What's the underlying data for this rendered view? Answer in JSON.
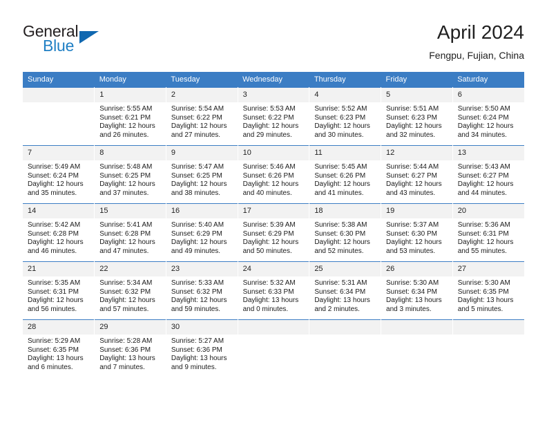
{
  "brand": {
    "name_part1": "General",
    "name_part2": "Blue",
    "triangle_icon": "triangle-logo-icon",
    "accent_color": "#1168b0"
  },
  "header": {
    "title": "April 2024",
    "subtitle": "Fengpu, Fujian, China"
  },
  "theme": {
    "header_row_bg": "#3b7dc4",
    "daynum_bg": "#f2f2f2",
    "grid_line": "#3b7dc4",
    "text": "#1a1a1a"
  },
  "weekday_headers": [
    "Sunday",
    "Monday",
    "Tuesday",
    "Wednesday",
    "Thursday",
    "Friday",
    "Saturday"
  ],
  "labels": {
    "sunrise_prefix": "Sunrise:",
    "sunset_prefix": "Sunset:",
    "daylight_prefix": "Daylight:"
  },
  "weeks": [
    [
      {
        "day": "",
        "sunrise": "",
        "sunset": "",
        "daylight_line1": "",
        "daylight_line2": ""
      },
      {
        "day": "1",
        "sunrise": "Sunrise: 5:55 AM",
        "sunset": "Sunset: 6:21 PM",
        "daylight_line1": "Daylight: 12 hours",
        "daylight_line2": "and 26 minutes."
      },
      {
        "day": "2",
        "sunrise": "Sunrise: 5:54 AM",
        "sunset": "Sunset: 6:22 PM",
        "daylight_line1": "Daylight: 12 hours",
        "daylight_line2": "and 27 minutes."
      },
      {
        "day": "3",
        "sunrise": "Sunrise: 5:53 AM",
        "sunset": "Sunset: 6:22 PM",
        "daylight_line1": "Daylight: 12 hours",
        "daylight_line2": "and 29 minutes."
      },
      {
        "day": "4",
        "sunrise": "Sunrise: 5:52 AM",
        "sunset": "Sunset: 6:23 PM",
        "daylight_line1": "Daylight: 12 hours",
        "daylight_line2": "and 30 minutes."
      },
      {
        "day": "5",
        "sunrise": "Sunrise: 5:51 AM",
        "sunset": "Sunset: 6:23 PM",
        "daylight_line1": "Daylight: 12 hours",
        "daylight_line2": "and 32 minutes."
      },
      {
        "day": "6",
        "sunrise": "Sunrise: 5:50 AM",
        "sunset": "Sunset: 6:24 PM",
        "daylight_line1": "Daylight: 12 hours",
        "daylight_line2": "and 34 minutes."
      }
    ],
    [
      {
        "day": "7",
        "sunrise": "Sunrise: 5:49 AM",
        "sunset": "Sunset: 6:24 PM",
        "daylight_line1": "Daylight: 12 hours",
        "daylight_line2": "and 35 minutes."
      },
      {
        "day": "8",
        "sunrise": "Sunrise: 5:48 AM",
        "sunset": "Sunset: 6:25 PM",
        "daylight_line1": "Daylight: 12 hours",
        "daylight_line2": "and 37 minutes."
      },
      {
        "day": "9",
        "sunrise": "Sunrise: 5:47 AM",
        "sunset": "Sunset: 6:25 PM",
        "daylight_line1": "Daylight: 12 hours",
        "daylight_line2": "and 38 minutes."
      },
      {
        "day": "10",
        "sunrise": "Sunrise: 5:46 AM",
        "sunset": "Sunset: 6:26 PM",
        "daylight_line1": "Daylight: 12 hours",
        "daylight_line2": "and 40 minutes."
      },
      {
        "day": "11",
        "sunrise": "Sunrise: 5:45 AM",
        "sunset": "Sunset: 6:26 PM",
        "daylight_line1": "Daylight: 12 hours",
        "daylight_line2": "and 41 minutes."
      },
      {
        "day": "12",
        "sunrise": "Sunrise: 5:44 AM",
        "sunset": "Sunset: 6:27 PM",
        "daylight_line1": "Daylight: 12 hours",
        "daylight_line2": "and 43 minutes."
      },
      {
        "day": "13",
        "sunrise": "Sunrise: 5:43 AM",
        "sunset": "Sunset: 6:27 PM",
        "daylight_line1": "Daylight: 12 hours",
        "daylight_line2": "and 44 minutes."
      }
    ],
    [
      {
        "day": "14",
        "sunrise": "Sunrise: 5:42 AM",
        "sunset": "Sunset: 6:28 PM",
        "daylight_line1": "Daylight: 12 hours",
        "daylight_line2": "and 46 minutes."
      },
      {
        "day": "15",
        "sunrise": "Sunrise: 5:41 AM",
        "sunset": "Sunset: 6:28 PM",
        "daylight_line1": "Daylight: 12 hours",
        "daylight_line2": "and 47 minutes."
      },
      {
        "day": "16",
        "sunrise": "Sunrise: 5:40 AM",
        "sunset": "Sunset: 6:29 PM",
        "daylight_line1": "Daylight: 12 hours",
        "daylight_line2": "and 49 minutes."
      },
      {
        "day": "17",
        "sunrise": "Sunrise: 5:39 AM",
        "sunset": "Sunset: 6:29 PM",
        "daylight_line1": "Daylight: 12 hours",
        "daylight_line2": "and 50 minutes."
      },
      {
        "day": "18",
        "sunrise": "Sunrise: 5:38 AM",
        "sunset": "Sunset: 6:30 PM",
        "daylight_line1": "Daylight: 12 hours",
        "daylight_line2": "and 52 minutes."
      },
      {
        "day": "19",
        "sunrise": "Sunrise: 5:37 AM",
        "sunset": "Sunset: 6:30 PM",
        "daylight_line1": "Daylight: 12 hours",
        "daylight_line2": "and 53 minutes."
      },
      {
        "day": "20",
        "sunrise": "Sunrise: 5:36 AM",
        "sunset": "Sunset: 6:31 PM",
        "daylight_line1": "Daylight: 12 hours",
        "daylight_line2": "and 55 minutes."
      }
    ],
    [
      {
        "day": "21",
        "sunrise": "Sunrise: 5:35 AM",
        "sunset": "Sunset: 6:31 PM",
        "daylight_line1": "Daylight: 12 hours",
        "daylight_line2": "and 56 minutes."
      },
      {
        "day": "22",
        "sunrise": "Sunrise: 5:34 AM",
        "sunset": "Sunset: 6:32 PM",
        "daylight_line1": "Daylight: 12 hours",
        "daylight_line2": "and 57 minutes."
      },
      {
        "day": "23",
        "sunrise": "Sunrise: 5:33 AM",
        "sunset": "Sunset: 6:32 PM",
        "daylight_line1": "Daylight: 12 hours",
        "daylight_line2": "and 59 minutes."
      },
      {
        "day": "24",
        "sunrise": "Sunrise: 5:32 AM",
        "sunset": "Sunset: 6:33 PM",
        "daylight_line1": "Daylight: 13 hours",
        "daylight_line2": "and 0 minutes."
      },
      {
        "day": "25",
        "sunrise": "Sunrise: 5:31 AM",
        "sunset": "Sunset: 6:34 PM",
        "daylight_line1": "Daylight: 13 hours",
        "daylight_line2": "and 2 minutes."
      },
      {
        "day": "26",
        "sunrise": "Sunrise: 5:30 AM",
        "sunset": "Sunset: 6:34 PM",
        "daylight_line1": "Daylight: 13 hours",
        "daylight_line2": "and 3 minutes."
      },
      {
        "day": "27",
        "sunrise": "Sunrise: 5:30 AM",
        "sunset": "Sunset: 6:35 PM",
        "daylight_line1": "Daylight: 13 hours",
        "daylight_line2": "and 5 minutes."
      }
    ],
    [
      {
        "day": "28",
        "sunrise": "Sunrise: 5:29 AM",
        "sunset": "Sunset: 6:35 PM",
        "daylight_line1": "Daylight: 13 hours",
        "daylight_line2": "and 6 minutes."
      },
      {
        "day": "29",
        "sunrise": "Sunrise: 5:28 AM",
        "sunset": "Sunset: 6:36 PM",
        "daylight_line1": "Daylight: 13 hours",
        "daylight_line2": "and 7 minutes."
      },
      {
        "day": "30",
        "sunrise": "Sunrise: 5:27 AM",
        "sunset": "Sunset: 6:36 PM",
        "daylight_line1": "Daylight: 13 hours",
        "daylight_line2": "and 9 minutes."
      },
      {
        "day": "",
        "sunrise": "",
        "sunset": "",
        "daylight_line1": "",
        "daylight_line2": ""
      },
      {
        "day": "",
        "sunrise": "",
        "sunset": "",
        "daylight_line1": "",
        "daylight_line2": ""
      },
      {
        "day": "",
        "sunrise": "",
        "sunset": "",
        "daylight_line1": "",
        "daylight_line2": ""
      },
      {
        "day": "",
        "sunrise": "",
        "sunset": "",
        "daylight_line1": "",
        "daylight_line2": ""
      }
    ]
  ]
}
